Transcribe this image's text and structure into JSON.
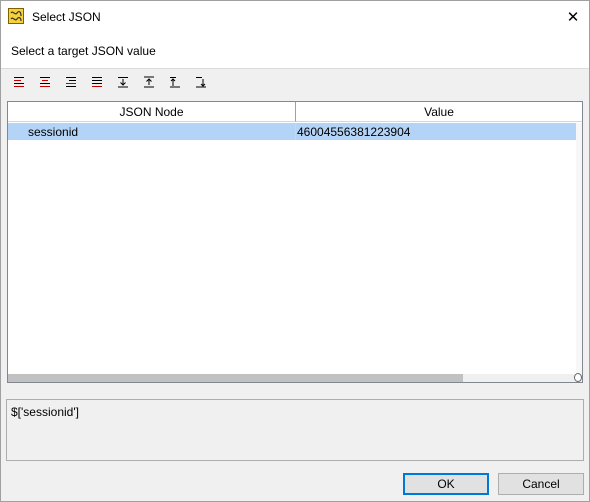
{
  "window": {
    "title": "Select JSON",
    "close_label": "✕"
  },
  "header": {
    "instruction": "Select a target JSON value"
  },
  "toolbar": {
    "buttons": [
      {
        "name": "align-left-icon"
      },
      {
        "name": "align-center-icon"
      },
      {
        "name": "align-right-icon"
      },
      {
        "name": "justify-icon"
      },
      {
        "name": "move-bottom-icon"
      },
      {
        "name": "move-top-icon"
      },
      {
        "name": "move-up-icon"
      },
      {
        "name": "move-down-icon"
      }
    ],
    "accent_color": "#c00000"
  },
  "grid": {
    "columns": [
      "JSON Node",
      "Value"
    ],
    "rows": [
      {
        "node": "sessionid",
        "value": "46004556381223904",
        "selected": true
      }
    ],
    "selection_color": "#b3d3f7"
  },
  "path": {
    "value": "$['sessionid']"
  },
  "buttons": {
    "ok": "OK",
    "cancel": "Cancel"
  }
}
